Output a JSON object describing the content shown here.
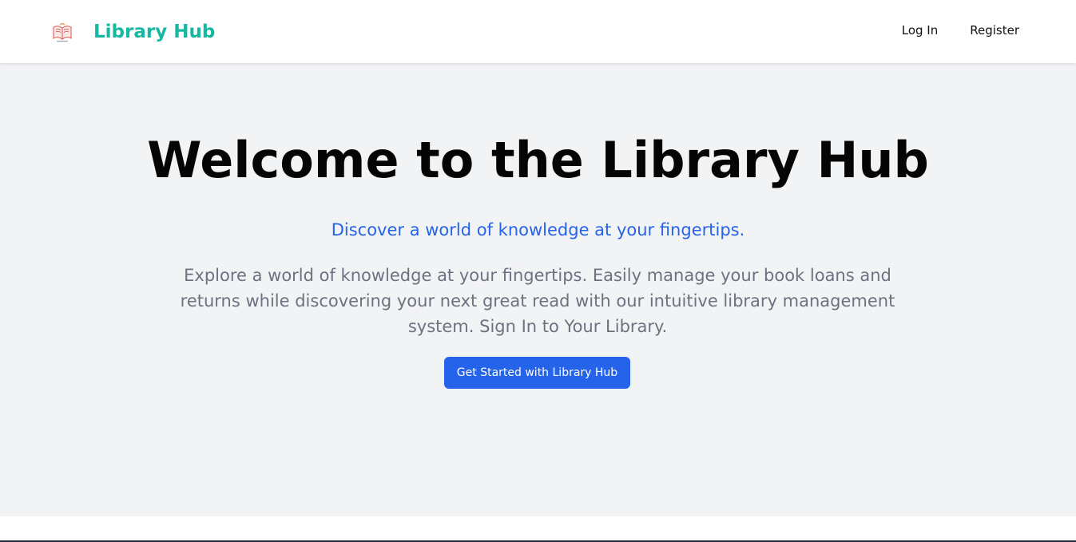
{
  "header": {
    "brand_name": "Library Hub",
    "nav": [
      {
        "label": "Log In"
      },
      {
        "label": "Register"
      }
    ]
  },
  "hero": {
    "title": "Welcome to the Library Hub",
    "subtitle": "Discover a world of knowledge at your fingertips.",
    "body": "Explore a world of knowledge at your fingertips. Easily manage your book loans and returns while discovering your next great read with our intuitive library management system. Sign In to Your Library.",
    "cta_label": "Get Started with Library Hub"
  },
  "icons": {
    "logo": "open-book-logo-icon"
  },
  "colors": {
    "brand": "#16b8a3",
    "accent": "#2563eb",
    "hero_background": "#f2f3f5",
    "body_text": "#6b7280"
  }
}
